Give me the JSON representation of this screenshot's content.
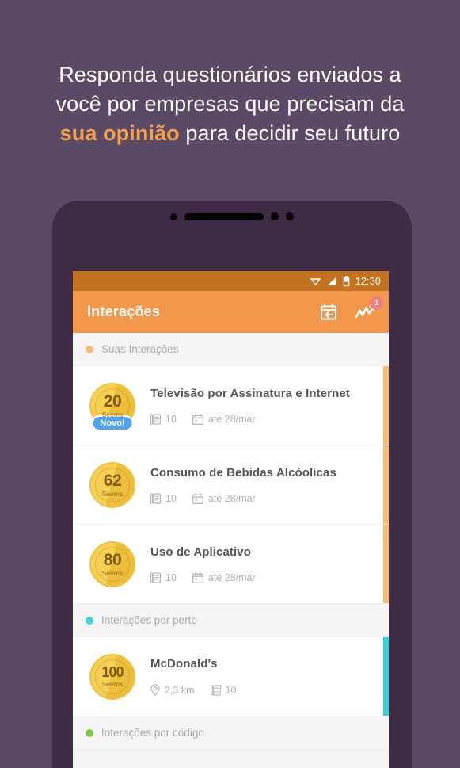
{
  "headline": {
    "line1": "Responda questionários enviados a",
    "line2": "você por empresas que precisam da",
    "line3_accent": "sua opinião",
    "line3_rest": " para decidir seu futuro",
    "accent_color": "#f5a04a"
  },
  "phone": {
    "statusbar": {
      "wifi_icon": "wifi-icon",
      "signal_icon": "signal-icon",
      "battery_icon": "battery-icon",
      "clock": "12:30",
      "bg_color": "#c3721f"
    },
    "appbar": {
      "title": "Interações",
      "bg_color": "#f3974c",
      "actions": [
        {
          "name": "calendar-back-icon",
          "badge": null
        },
        {
          "name": "trending-chart-icon",
          "badge": "1"
        }
      ]
    }
  },
  "sections": [
    {
      "label": "Suas Interações",
      "dot_color": "#f8b878",
      "accent_color": "#f9bd72",
      "items": [
        {
          "coin_value": "20",
          "coin_unit": "Seems",
          "new_badge": "Novo!",
          "title": "Televisão por Assinatura e Internet",
          "meta": [
            {
              "icon": "survey-icon",
              "text": "10"
            },
            {
              "icon": "calendar-icon",
              "text": "até 28/mar"
            }
          ]
        },
        {
          "coin_value": "62",
          "coin_unit": "Seems",
          "new_badge": null,
          "title": "Consumo de Bebidas Alcóolicas",
          "meta": [
            {
              "icon": "survey-icon",
              "text": "10"
            },
            {
              "icon": "calendar-icon",
              "text": "até 28/mar"
            }
          ]
        },
        {
          "coin_value": "80",
          "coin_unit": "Seems",
          "new_badge": null,
          "title": "Uso de Aplicativo",
          "meta": [
            {
              "icon": "survey-icon",
              "text": "10"
            },
            {
              "icon": "calendar-icon",
              "text": "até 28/mar"
            }
          ]
        }
      ]
    },
    {
      "label": "Interações por perto",
      "dot_color": "#3fd6d6",
      "accent_color": "#35d3d8",
      "items": [
        {
          "coin_value": "100",
          "coin_unit": "Seems",
          "new_badge": null,
          "title": "McDonald's",
          "meta": [
            {
              "icon": "location-pin-icon",
              "text": "2,3 km"
            },
            {
              "icon": "survey-icon",
              "text": "10"
            }
          ]
        }
      ]
    },
    {
      "label": "Interações por código",
      "dot_color": "#7ac943",
      "accent_color": "#7ac943",
      "items": []
    }
  ]
}
